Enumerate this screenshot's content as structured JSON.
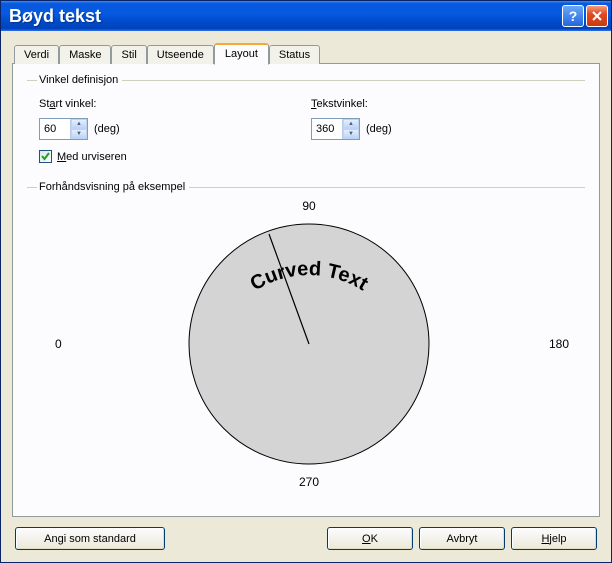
{
  "window": {
    "title": "Bøyd tekst"
  },
  "tabs": {
    "verdi": "Verdi",
    "maske": "Maske",
    "stil": "Stil",
    "utseende": "Utseende",
    "layout": "Layout",
    "status": "Status"
  },
  "angle_group": {
    "legend": "Vinkel definisjon",
    "start_label_pre": "St",
    "start_label_key": "a",
    "start_label_post": "rt vinkel:",
    "start_value": "60",
    "text_label_key": "T",
    "text_label_post": "ekstvinkel:",
    "text_value": "360",
    "deg": "(deg)",
    "clockwise_key": "M",
    "clockwise_post": "ed urviseren"
  },
  "preview_group": {
    "legend": "Forhåndsvisning på eksempel",
    "curved_text": "Curved Text",
    "axis": {
      "n90": "90",
      "n180": "180",
      "n270": "270",
      "n0": "0"
    }
  },
  "buttons": {
    "default": "Angi som standard",
    "ok_key": "O",
    "ok_post": "K",
    "cancel": "Avbryt",
    "help_key": "H",
    "help_post": "jelp"
  },
  "chart_data": {
    "type": "pie",
    "title": "Curved Text",
    "start_angle_deg": 60,
    "text_angle_deg": 360,
    "clockwise": true,
    "axis_labels": [
      0,
      90,
      180,
      270
    ],
    "indicator_line_from_center_deg": 60
  }
}
